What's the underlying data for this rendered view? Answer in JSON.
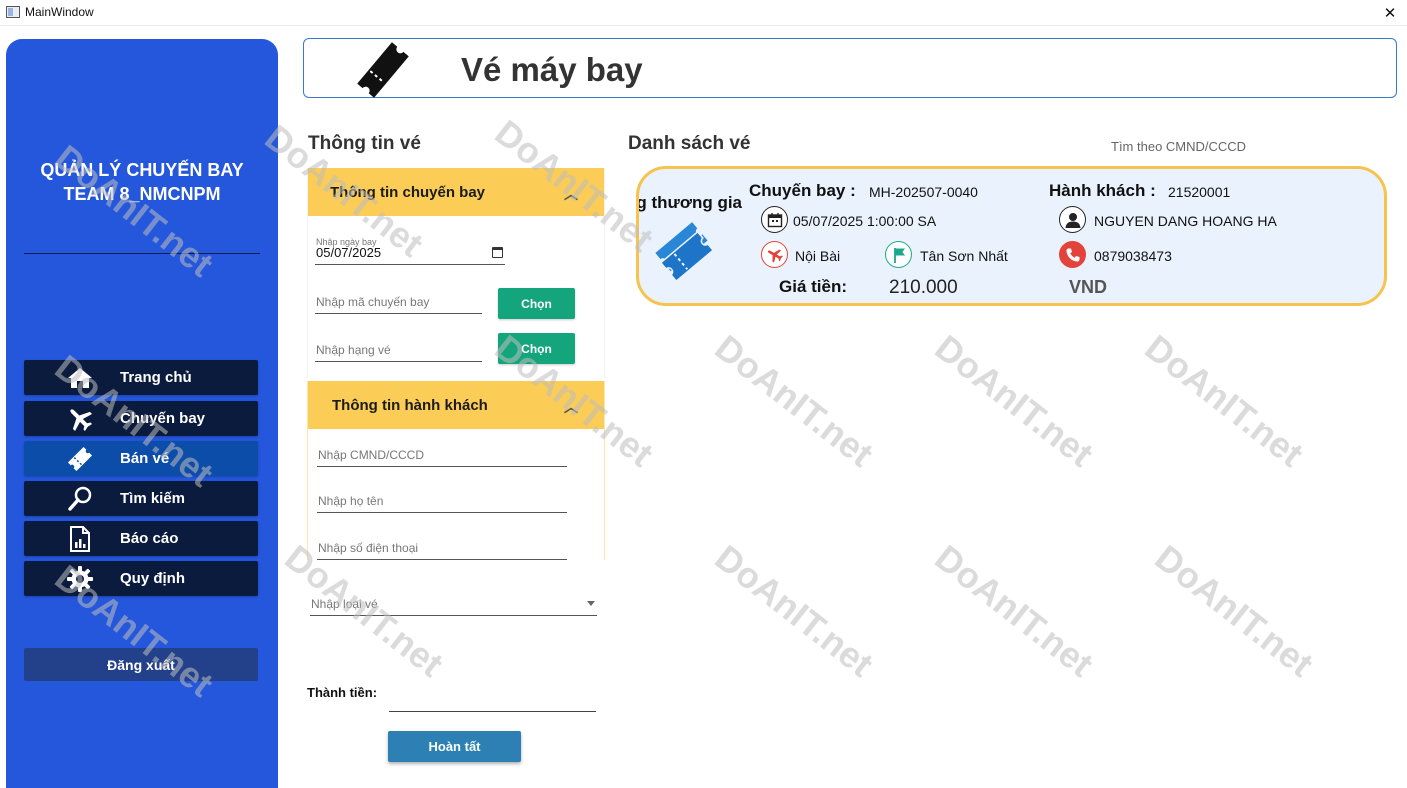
{
  "window": {
    "title": "MainWindow",
    "close_glyph": "✕"
  },
  "sidebar": {
    "brand_line1": "QUẢN LÝ CHUYẾN BAY",
    "brand_line2": "TEAM 8_NMCNPM",
    "items": [
      {
        "label": "Trang chủ",
        "icon": "home-icon"
      },
      {
        "label": "Chuyến bay",
        "icon": "airplane-icon"
      },
      {
        "label": "Bán vé",
        "icon": "ticket-icon",
        "active": true
      },
      {
        "label": "Tìm kiếm",
        "icon": "search-icon"
      },
      {
        "label": "Báo cáo",
        "icon": "report-icon"
      },
      {
        "label": "Quy định",
        "icon": "gear-icon"
      }
    ],
    "logout_label": "Đăng xuất"
  },
  "header": {
    "title": "Vé máy bay",
    "icon": "ticket-icon"
  },
  "ticket_form": {
    "section_title": "Thông tin vé",
    "flight_panel": {
      "title": "Thông tin chuyến bay",
      "date_label": "Nhập ngày bay",
      "date_value": "05/07/2025",
      "flight_code_placeholder": "Nhập mã chuyến bay",
      "class_placeholder": "Nhập hạng vé",
      "choose_label": "Chọn"
    },
    "passenger_panel": {
      "title": "Thông tin hành khách",
      "id_placeholder": "Nhập CMND/CCCD",
      "name_placeholder": "Nhập họ tên",
      "phone_placeholder": "Nhập số điện thoại"
    },
    "ticket_type_placeholder": "Nhập loại vé",
    "total_label": "Thành tiền:",
    "finish_label": "Hoàn tất"
  },
  "ticket_list": {
    "section_title": "Danh sách vé",
    "search_label": "Tìm theo CMND/CCCD",
    "tickets": [
      {
        "class_text": "Hạng thương gia",
        "flight_label": "Chuyến bay :",
        "flight_code": "MH-202507-0040",
        "passenger_label": "Hành khách :",
        "passenger_id": "21520001",
        "datetime": "05/07/2025 1:00:00 SA",
        "passenger_name": "NGUYEN DANG HOANG HA",
        "from": "Nội Bài",
        "to": "Tân Sơn Nhất",
        "phone": "0879038473",
        "price_label": "Giá tiền:",
        "price": "210.000",
        "currency": "VND"
      }
    ]
  },
  "watermark": {
    "text": "DoAnIT.net"
  },
  "colors": {
    "sidebar": "#2457dc",
    "nav": "#0b1b3d",
    "nav_active": "#0d4daa",
    "panel_header": "#fbcd57",
    "choose_button": "#14a57c",
    "finish_button": "#2c80b4",
    "card_border": "#f6c34e",
    "card_bg": "#eaf3fd"
  }
}
